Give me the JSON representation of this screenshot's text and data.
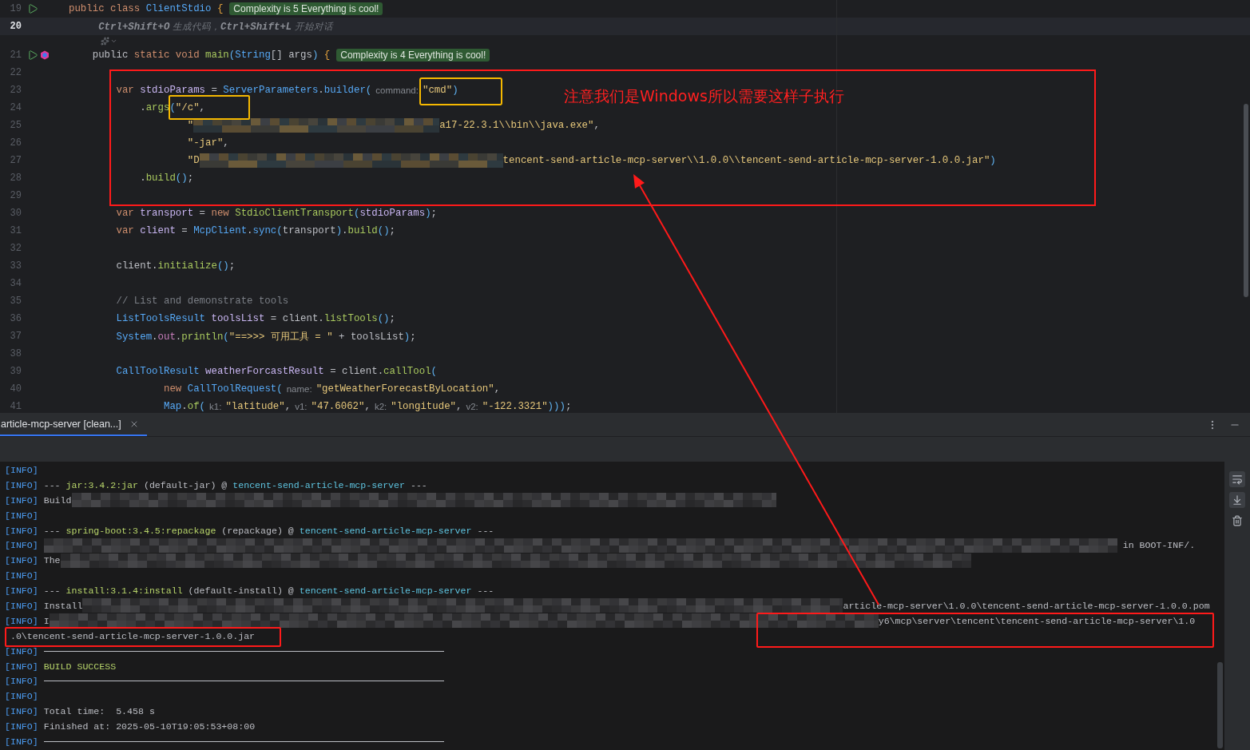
{
  "editor": {
    "lines": [
      {
        "number": "19",
        "current": false,
        "gutter": [
          {
            "kind": "run"
          }
        ],
        "segments": [
          {
            "kind": "kw",
            "text": "public class "
          },
          {
            "kind": "cls",
            "text": "ClientStdio "
          },
          {
            "kind": "brace",
            "text": "{"
          },
          {
            "kind": "badge",
            "text": "Complexity is 5 Everything is cool!"
          }
        ]
      },
      {
        "number": "20",
        "current": true,
        "segments": [
          {
            "kind": "ai-key",
            "text": "     Ctrl+Shift+O"
          },
          {
            "kind": "ai-text",
            "text": " 生成代码，"
          },
          {
            "kind": "ai-key",
            "text": "Ctrl+Shift+L"
          },
          {
            "kind": "ai-text",
            "text": " 开始对话"
          }
        ],
        "inline_actions": [
          {
            "kind": "assistant"
          },
          {
            "kind": "chevron"
          }
        ]
      },
      {
        "number": "21",
        "current": false,
        "gutter": [
          {
            "kind": "run"
          },
          {
            "kind": "hexagon"
          }
        ],
        "segments": [
          {
            "kind": "plain",
            "text": "    public "
          },
          {
            "kind": "kw",
            "text": "static void "
          },
          {
            "kind": "method",
            "text": "main"
          },
          {
            "kind": "paren",
            "text": "("
          },
          {
            "kind": "cls",
            "text": "String"
          },
          {
            "kind": "plain",
            "text": "[] args"
          },
          {
            "kind": "paren",
            "text": ")"
          },
          {
            "kind": "brace",
            "text": " {"
          },
          {
            "kind": "badge",
            "text": "Complexity is 4 Everything is cool!"
          }
        ]
      },
      {
        "number": "22",
        "current": false
      },
      {
        "number": "23",
        "current": false,
        "segments": [
          {
            "kind": "kw",
            "text": "        var "
          },
          {
            "kind": "var",
            "text": "stdioParams"
          },
          {
            "kind": "plain",
            "text": " = "
          },
          {
            "kind": "cls",
            "text": "ServerParameters"
          },
          {
            "kind": "plain",
            "text": "."
          },
          {
            "kind": "cls",
            "text": "builder"
          },
          {
            "kind": "paren",
            "text": "("
          },
          {
            "kind": "hint",
            "text": "command:"
          },
          {
            "kind": "str",
            "text": "\"cmd\""
          },
          {
            "kind": "paren",
            "text": ")"
          }
        ]
      },
      {
        "number": "24",
        "current": false,
        "segments": [
          {
            "kind": "plain",
            "text": "            ."
          },
          {
            "kind": "method",
            "text": "args"
          },
          {
            "kind": "paren",
            "text": "("
          },
          {
            "kind": "str",
            "text": "\"/c\""
          },
          {
            "kind": "plain",
            "text": ","
          }
        ]
      },
      {
        "number": "25",
        "current": false,
        "segments": [
          {
            "kind": "str",
            "text": "                    \""
          },
          {
            "kind": "blur"
          },
          {
            "kind": "str",
            "text": "a17-22.3.1\\\\bin\\\\java.exe\""
          },
          {
            "kind": "plain",
            "text": ","
          }
        ]
      },
      {
        "number": "26",
        "current": false,
        "segments": [
          {
            "kind": "str",
            "text": "                    \"-jar\""
          },
          {
            "kind": "plain",
            "text": ","
          }
        ]
      },
      {
        "number": "27",
        "current": false,
        "segments": [
          {
            "kind": "str",
            "text": "                    \"D"
          },
          {
            "kind": "blur"
          },
          {
            "kind": "str",
            "text": "tencent-send-article-mcp-server\\\\1.0.0\\\\tencent-send-article-mcp-server-1.0.0.jar\""
          },
          {
            "kind": "paren",
            "text": ")"
          }
        ]
      },
      {
        "number": "28",
        "current": false,
        "segments": [
          {
            "kind": "plain",
            "text": "            ."
          },
          {
            "kind": "method",
            "text": "build"
          },
          {
            "kind": "paren",
            "text": "()"
          },
          {
            "kind": "plain",
            "text": ";"
          }
        ]
      },
      {
        "number": "29",
        "current": false
      },
      {
        "number": "30",
        "current": false,
        "segments": [
          {
            "kind": "kw",
            "text": "        var "
          },
          {
            "kind": "var",
            "text": "transport"
          },
          {
            "kind": "plain",
            "text": " = "
          },
          {
            "kind": "kw",
            "text": "new "
          },
          {
            "kind": "method",
            "text": "StdioClientTransport"
          },
          {
            "kind": "paren",
            "text": "("
          },
          {
            "kind": "var",
            "text": "stdioParams"
          },
          {
            "kind": "paren",
            "text": ")"
          },
          {
            "kind": "plain",
            "text": ";"
          }
        ]
      },
      {
        "number": "31",
        "current": false,
        "segments": [
          {
            "kind": "kw",
            "text": "        var "
          },
          {
            "kind": "var",
            "text": "client"
          },
          {
            "kind": "plain",
            "text": " = "
          },
          {
            "kind": "cls",
            "text": "McpClient"
          },
          {
            "kind": "plain",
            "text": "."
          },
          {
            "kind": "cls",
            "text": "sync"
          },
          {
            "kind": "paren",
            "text": "("
          },
          {
            "kind": "plain",
            "text": "transport"
          },
          {
            "kind": "paren",
            "text": ")"
          },
          {
            "kind": "plain",
            "text": "."
          },
          {
            "kind": "method",
            "text": "build"
          },
          {
            "kind": "paren",
            "text": "()"
          },
          {
            "kind": "plain",
            "text": ";"
          }
        ]
      },
      {
        "number": "32",
        "current": false
      },
      {
        "number": "33",
        "current": false,
        "segments": [
          {
            "kind": "plain",
            "text": "        client."
          },
          {
            "kind": "method",
            "text": "initialize"
          },
          {
            "kind": "paren",
            "text": "()"
          },
          {
            "kind": "plain",
            "text": ";"
          }
        ]
      },
      {
        "number": "34",
        "current": false
      },
      {
        "number": "35",
        "current": false,
        "segments": [
          {
            "kind": "comment",
            "text": "        // List and demonstrate tools"
          }
        ]
      },
      {
        "number": "36",
        "current": false,
        "segments": [
          {
            "kind": "cls",
            "text": "        ListToolsResult"
          },
          {
            "kind": "var",
            "text": " toolsList"
          },
          {
            "kind": "plain",
            "text": " = client."
          },
          {
            "kind": "method",
            "text": "listTools"
          },
          {
            "kind": "paren",
            "text": "()"
          },
          {
            "kind": "plain",
            "text": ";"
          }
        ]
      },
      {
        "number": "37",
        "current": false,
        "segments": [
          {
            "kind": "cls",
            "text": "        System"
          },
          {
            "kind": "plain",
            "text": "."
          },
          {
            "kind": "field",
            "text": "out"
          },
          {
            "kind": "plain",
            "text": "."
          },
          {
            "kind": "method",
            "text": "println"
          },
          {
            "kind": "paren",
            "text": "("
          },
          {
            "kind": "str",
            "text": "\"==>>> 可用工具 = \""
          },
          {
            "kind": "plain",
            "text": " + toolsList"
          },
          {
            "kind": "paren",
            "text": ")"
          },
          {
            "kind": "plain",
            "text": ";"
          }
        ]
      },
      {
        "number": "38",
        "current": false
      },
      {
        "number": "39",
        "current": false,
        "segments": [
          {
            "kind": "cls",
            "text": "        CallToolResult"
          },
          {
            "kind": "var",
            "text": " weatherForcastResult"
          },
          {
            "kind": "plain",
            "text": " = client."
          },
          {
            "kind": "method",
            "text": "callTool"
          },
          {
            "kind": "paren",
            "text": "("
          }
        ]
      },
      {
        "number": "40",
        "current": false,
        "segments": [
          {
            "kind": "kw",
            "text": "                new "
          },
          {
            "kind": "cls",
            "text": "CallToolRequest"
          },
          {
            "kind": "paren",
            "text": "("
          },
          {
            "kind": "hint",
            "text": "name:"
          },
          {
            "kind": "str",
            "text": "\"getWeatherForecastByLocation\""
          },
          {
            "kind": "plain",
            "text": ","
          }
        ]
      },
      {
        "number": "41",
        "current": false,
        "segments": [
          {
            "kind": "cls",
            "text": "                Map"
          },
          {
            "kind": "plain",
            "text": "."
          },
          {
            "kind": "method",
            "text": "of"
          },
          {
            "kind": "paren",
            "text": "("
          },
          {
            "kind": "hint",
            "text": "k1:"
          },
          {
            "kind": "str",
            "text": "\"latitude\""
          },
          {
            "kind": "plain",
            "text": ","
          },
          {
            "kind": "hint",
            "text": "v1:"
          },
          {
            "kind": "str",
            "text": "\"47.6062\""
          },
          {
            "kind": "plain",
            "text": ","
          },
          {
            "kind": "hint",
            "text": "k2:"
          },
          {
            "kind": "str",
            "text": "\"longitude\""
          },
          {
            "kind": "plain",
            "text": ","
          },
          {
            "kind": "hint",
            "text": "v2:"
          },
          {
            "kind": "str",
            "text": "\"-122.3321\""
          },
          {
            "kind": "paren",
            "text": ")))"
          },
          {
            "kind": "plain",
            "text": ";"
          }
        ]
      }
    ]
  },
  "run_panel": {
    "tabs": [
      {
        "label": "article-mcp-server [clean...]",
        "selected": true
      }
    ],
    "lines": [
      {
        "segments": [
          {
            "kind": "tag",
            "text": "[INFO]"
          }
        ]
      },
      {
        "segments": [
          {
            "kind": "tag",
            "text": "[INFO]"
          },
          {
            "kind": "plain",
            "text": " --- "
          },
          {
            "kind": "goal",
            "text": "jar:3.4.2:jar"
          },
          {
            "kind": "plain",
            "text": " (default-jar) @ "
          },
          {
            "kind": "artifact",
            "text": "tencent-send-article-mcp-server"
          },
          {
            "kind": "plain",
            "text": " ---"
          }
        ]
      },
      {
        "segments": [
          {
            "kind": "tag",
            "text": "[INFO]"
          },
          {
            "kind": "plain",
            "text": " Build"
          },
          {
            "kind": "blur"
          }
        ]
      },
      {
        "segments": [
          {
            "kind": "tag",
            "text": "[INFO]"
          }
        ]
      },
      {
        "segments": [
          {
            "kind": "tag",
            "text": "[INFO]"
          },
          {
            "kind": "plain",
            "text": " --- "
          },
          {
            "kind": "goal",
            "text": "spring-boot:3.4.5:repackage"
          },
          {
            "kind": "plain",
            "text": " (repackage) @ "
          },
          {
            "kind": "artifact",
            "text": "tencent-send-article-mcp-server"
          },
          {
            "kind": "plain",
            "text": " ---"
          }
        ]
      },
      {
        "segments": [
          {
            "kind": "tag",
            "text": "[INFO]"
          },
          {
            "kind": "blur"
          },
          {
            "kind": "plain",
            "text": " in BOOT-INF/."
          }
        ]
      },
      {
        "segments": [
          {
            "kind": "tag",
            "text": "[INFO]"
          },
          {
            "kind": "plain",
            "text": " The"
          },
          {
            "kind": "blur"
          }
        ]
      },
      {
        "segments": [
          {
            "kind": "tag",
            "text": "[INFO]"
          }
        ]
      },
      {
        "segments": [
          {
            "kind": "tag",
            "text": "[INFO]"
          },
          {
            "kind": "plain",
            "text": " --- "
          },
          {
            "kind": "goal",
            "text": "install:3.1.4:install"
          },
          {
            "kind": "plain",
            "text": " (default-install) @ "
          },
          {
            "kind": "artifact",
            "text": "tencent-send-article-mcp-server"
          },
          {
            "kind": "plain",
            "text": " ---"
          }
        ]
      },
      {
        "segments": [
          {
            "kind": "tag",
            "text": "[INFO]"
          },
          {
            "kind": "plain",
            "text": " Install"
          },
          {
            "kind": "blur"
          },
          {
            "kind": "plain",
            "text": "article-mcp-server\\1.0.0\\tencent-send-article-mcp-server-1.0.0.pom"
          }
        ]
      },
      {
        "segments": [
          {
            "kind": "tag",
            "text": "[INFO]"
          },
          {
            "kind": "plain",
            "text": " I"
          },
          {
            "kind": "blur"
          },
          {
            "kind": "plain",
            "text": "y6\\mcp\\server\\tencent\\tencent-send-article-mcp-server\\1.0"
          }
        ]
      },
      {
        "segments": [
          {
            "kind": "plain",
            "text": " .0\\tencent-send-article-mcp-server-1.0.0.jar"
          }
        ]
      },
      {
        "segments": [
          {
            "kind": "tag",
            "text": "[INFO]"
          },
          {
            "kind": "rule"
          }
        ]
      },
      {
        "segments": [
          {
            "kind": "tag",
            "text": "[INFO]"
          },
          {
            "kind": "success",
            "text": " BUILD SUCCESS"
          }
        ]
      },
      {
        "segments": [
          {
            "kind": "tag",
            "text": "[INFO]"
          },
          {
            "kind": "rule"
          }
        ]
      },
      {
        "segments": [
          {
            "kind": "tag",
            "text": "[INFO]"
          }
        ]
      },
      {
        "segments": [
          {
            "kind": "tag",
            "text": "[INFO]"
          },
          {
            "kind": "plain",
            "text": " Total time:  5.458 s"
          }
        ]
      },
      {
        "segments": [
          {
            "kind": "tag",
            "text": "[INFO]"
          },
          {
            "kind": "plain",
            "text": " Finished at: 2025-05-10T19:05:53+08:00"
          }
        ]
      },
      {
        "segments": [
          {
            "kind": "tag",
            "text": "[INFO]"
          },
          {
            "kind": "rule"
          }
        ]
      }
    ]
  },
  "annotations": {
    "note": "注意我们是Windows所以需要这样子执行",
    "frames": [
      {
        "color": "#ff1a1a"
      },
      {
        "color": "#f5b800"
      },
      {
        "color": "#f5b800"
      },
      {
        "color": "#ff1a1a"
      },
      {
        "color": "#ff1a1a"
      }
    ],
    "arrow": {
      "color": "#ff1a1a"
    }
  }
}
